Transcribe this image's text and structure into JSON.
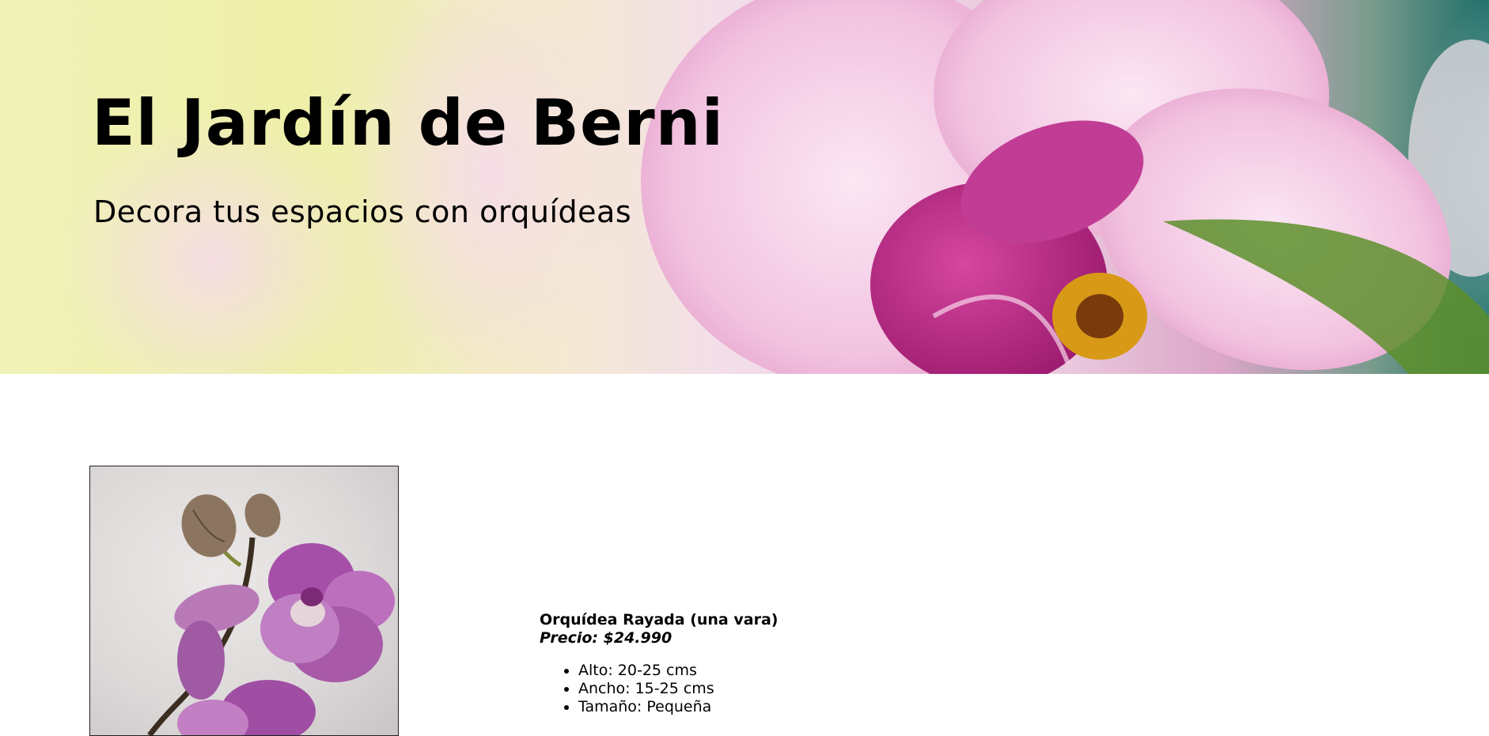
{
  "header": {
    "title": "El Jardín de Berni",
    "subtitle": "Decora tus espacios con orquídeas"
  },
  "product": {
    "name": "Orquídea Rayada (una vara)",
    "price": "Precio: $24.990",
    "specs": [
      "Alto: 20-25 cms",
      "Ancho: 15-25 cms",
      "Tamaño: Pequeña"
    ]
  },
  "colors": {
    "orchid_pink": "#e9a9d3",
    "orchid_magenta": "#b8348f",
    "lip_yellow": "#d9a11e",
    "teal_background": "#1d6d68"
  }
}
